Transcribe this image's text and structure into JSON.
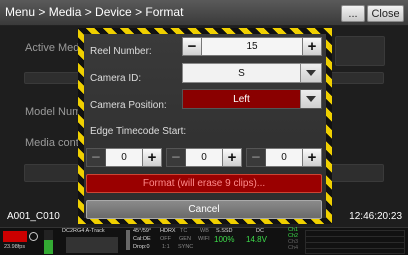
{
  "header": {
    "breadcrumb": "Menu > Media > Device > Format",
    "more_label": "...",
    "close_label": "Close"
  },
  "background": {
    "labels": [
      "Active Media",
      "Model Num",
      "Media conte"
    ]
  },
  "modal": {
    "reel_label": "Reel Number:",
    "reel_value": "15",
    "camera_id_label": "Camera ID:",
    "camera_id_value": "S",
    "camera_position_label": "Camera Position:",
    "camera_position_value": "Left",
    "edge_tc_label": "Edge Timecode Start:",
    "edge_tc_values": [
      "0",
      "0",
      "0"
    ],
    "format_label": "Format (will erase 9 clips)...",
    "cancel_label": "Cancel"
  },
  "overlay": {
    "clip_name": "A001_C010",
    "timecode": "12:46:20:23"
  },
  "status": {
    "fps": "23.98fps",
    "track": "DC2RG4  A-Track",
    "shutter": "45°/59°",
    "cal": "Cal:OE",
    "drop": "Drop:0",
    "hdrx": "HDRX",
    "off": "OFF",
    "ratio": "1:1",
    "tc": "TC",
    "gen": "GEN",
    "sync": "SYNC",
    "wb": "WB",
    "wifi": "WIFI",
    "ssd_label": "S.SSD",
    "ssd_value": "100%",
    "dc_label": "DC",
    "dc_value": "14.8V",
    "ch": [
      "Ch1",
      "Ch2",
      "Ch3",
      "Ch4"
    ]
  },
  "colors": {
    "hazard_yellow": "#f0d000",
    "format_red": "#9a0000",
    "position_red": "#8a0000",
    "value_green": "#3ddc4a"
  }
}
